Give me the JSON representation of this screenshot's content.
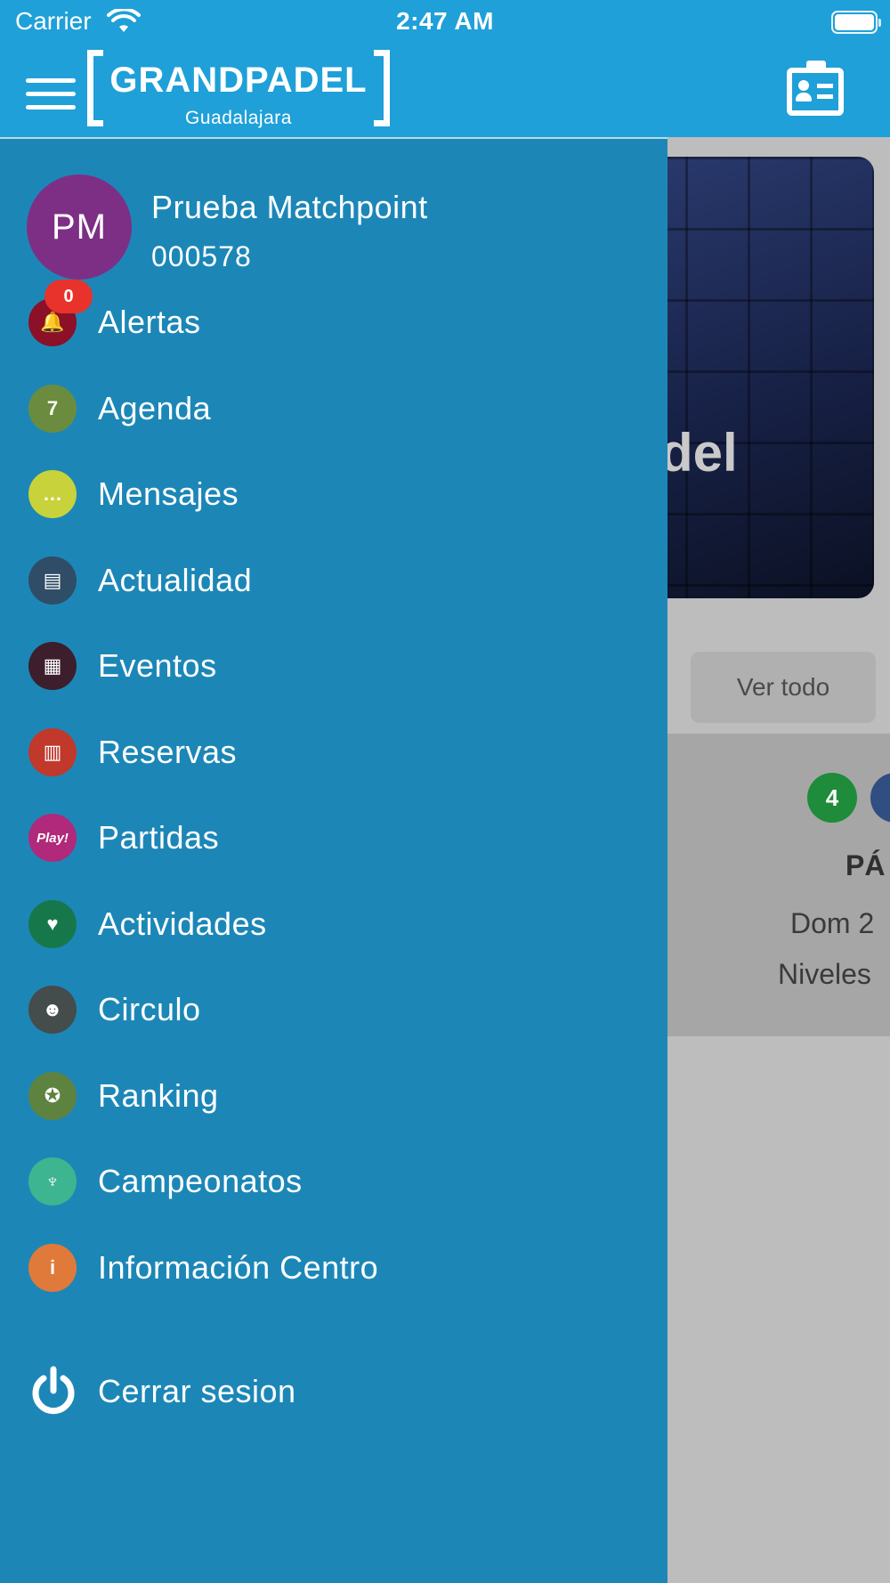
{
  "status_bar": {
    "carrier": "Carrier",
    "time": "2:47 AM"
  },
  "header": {
    "logo_text": "GRANDPADEL",
    "logo_subtitle": "Guadalajara"
  },
  "background": {
    "banner_text": "del",
    "ver_todo": "Ver todo",
    "badge_number": "4",
    "card_title": "PÁ",
    "card_date": "Dom 2",
    "card_level": "Niveles"
  },
  "user": {
    "initials": "PM",
    "name": "Prueba Matchpoint",
    "id": "000578",
    "avatar_color": "#7d2f86"
  },
  "alerts_badge": "0",
  "menu": {
    "items": [
      {
        "label": "Alertas",
        "icon": "bell-icon",
        "color": "#8b1028"
      },
      {
        "label": "Agenda",
        "icon": "calendar-icon",
        "color": "#6b8c3e"
      },
      {
        "label": "Mensajes",
        "icon": "chat-bubble-icon",
        "color": "#c8d23a"
      },
      {
        "label": "Actualidad",
        "icon": "newspaper-icon",
        "color": "#2f4d66"
      },
      {
        "label": "Eventos",
        "icon": "calendar-grid-icon",
        "color": "#3d1e2c"
      },
      {
        "label": "Reservas",
        "icon": "court-icon",
        "color": "#c0392b"
      },
      {
        "label": "Partidas",
        "icon": "play-icon",
        "color": "#b0297a"
      },
      {
        "label": "Actividades",
        "icon": "heart-check-icon",
        "color": "#16784a"
      },
      {
        "label": "Circulo",
        "icon": "group-icon",
        "color": "#444c4c"
      },
      {
        "label": "Ranking",
        "icon": "award-icon",
        "color": "#5e8240"
      },
      {
        "label": "Campeonatos",
        "icon": "trophy-icon",
        "color": "#3db591"
      },
      {
        "label": "Información Centro",
        "icon": "info-icon",
        "color": "#e07a3a"
      }
    ],
    "icon_glyphs": [
      "🔔",
      "7",
      "…",
      "▤",
      "▦",
      "▥",
      "Play!",
      "♥",
      "☻",
      "✪",
      "♆",
      "i"
    ],
    "logout_label": "Cerrar sesion"
  }
}
